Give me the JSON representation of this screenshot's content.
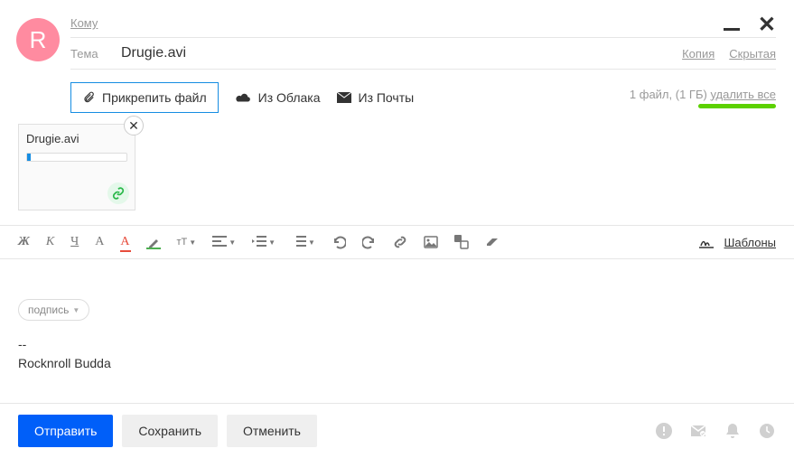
{
  "avatar": {
    "letter": "R"
  },
  "fields": {
    "to_label": "Кому",
    "subject_label": "Тема",
    "subject_value": "Drugie.avi",
    "cc_label": "Копия",
    "bcc_label": "Скрытая"
  },
  "attach": {
    "button": "Прикрепить файл",
    "from_cloud": "Из Облака",
    "from_mail": "Из Почты",
    "info_prefix": "1 файл, (1 ГБ) ",
    "delete_all": "удалить все"
  },
  "attachment": {
    "name": "Drugie.avi"
  },
  "toolbar": {
    "templates": "Шаблоны"
  },
  "body": {
    "signature_button": "подпись",
    "sig_divider": "--",
    "sig_name": "Rocknroll Budda"
  },
  "footer": {
    "send": "Отправить",
    "save": "Сохранить",
    "cancel": "Отменить"
  }
}
